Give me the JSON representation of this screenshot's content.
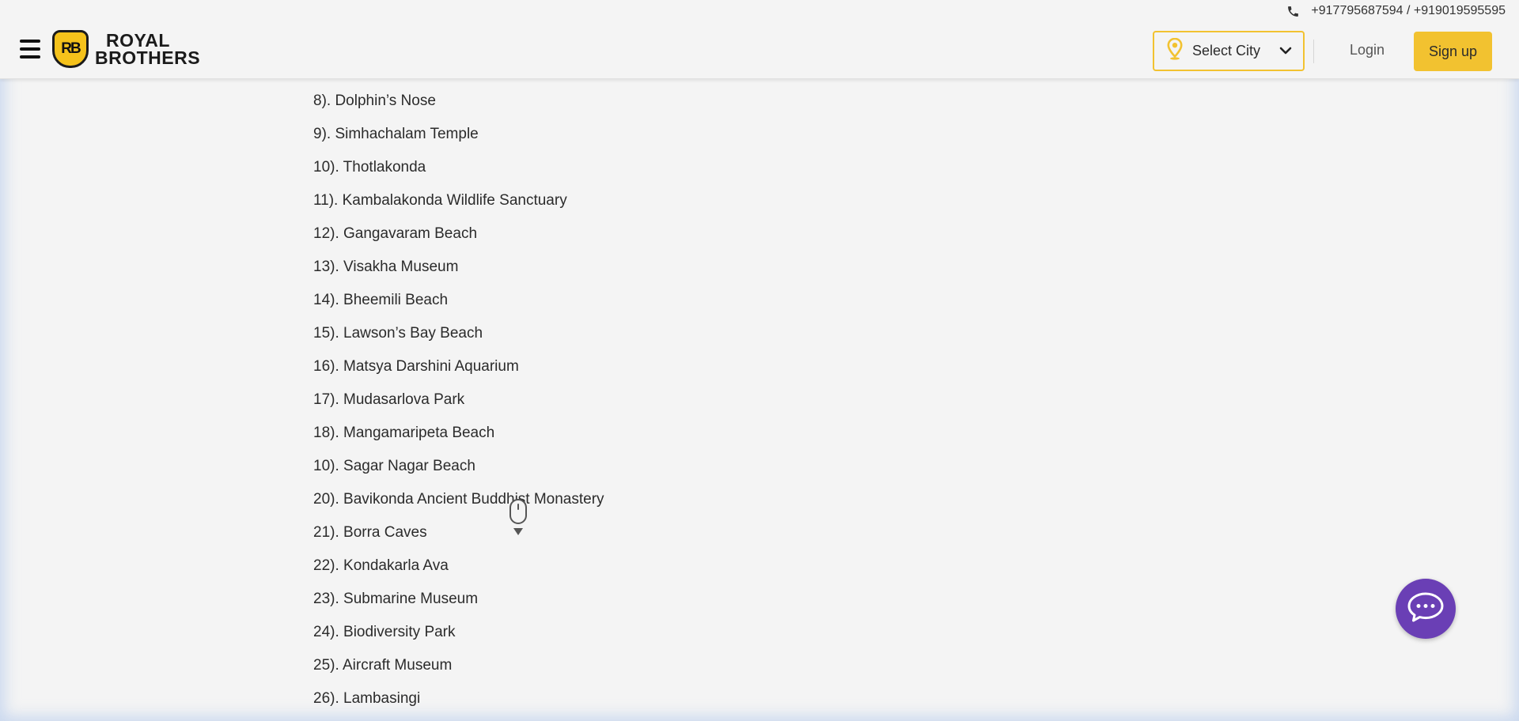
{
  "header": {
    "phone_numbers": "+917795687594 / +919019595595",
    "brand": {
      "badge": "RB",
      "line1": "ROYAL",
      "line2": "BROTHERS"
    },
    "city_select": {
      "label": "Select City"
    },
    "login_label": "Login",
    "signup_label": "Sign up"
  },
  "places": [
    "8). Dolphin’s Nose",
    "9). Simhachalam Temple",
    "10). Thotlakonda",
    "11). Kambalakonda Wildlife Sanctuary",
    "12). Gangavaram Beach",
    "13). Visakha Museum",
    "14). Bheemili Beach",
    "15). Lawson’s Bay Beach",
    "16). Matsya Darshini Aquarium",
    "17). Mudasarlova Park",
    "18). Mangamaripeta Beach",
    "10). Sagar Nagar Beach",
    "20). Bavikonda Ancient Buddhist Monastery",
    "21). Borra Caves",
    "22). Kondakarla Ava",
    "23). Submarine Museum",
    "24). Biodiversity Park",
    "25). Aircraft Museum",
    "26). Lambasingi"
  ],
  "icons": {
    "phone": "phone-icon",
    "menu": "hamburger-icon",
    "location": "location-pin-icon",
    "dropdown": "chevron-down-icon",
    "scroll": "mouse-scroll-icon",
    "chat": "chat-bubble-icon"
  },
  "colors": {
    "accent": "#f2c230",
    "chat": "#6a3fb5",
    "background": "#f4f4f4"
  }
}
